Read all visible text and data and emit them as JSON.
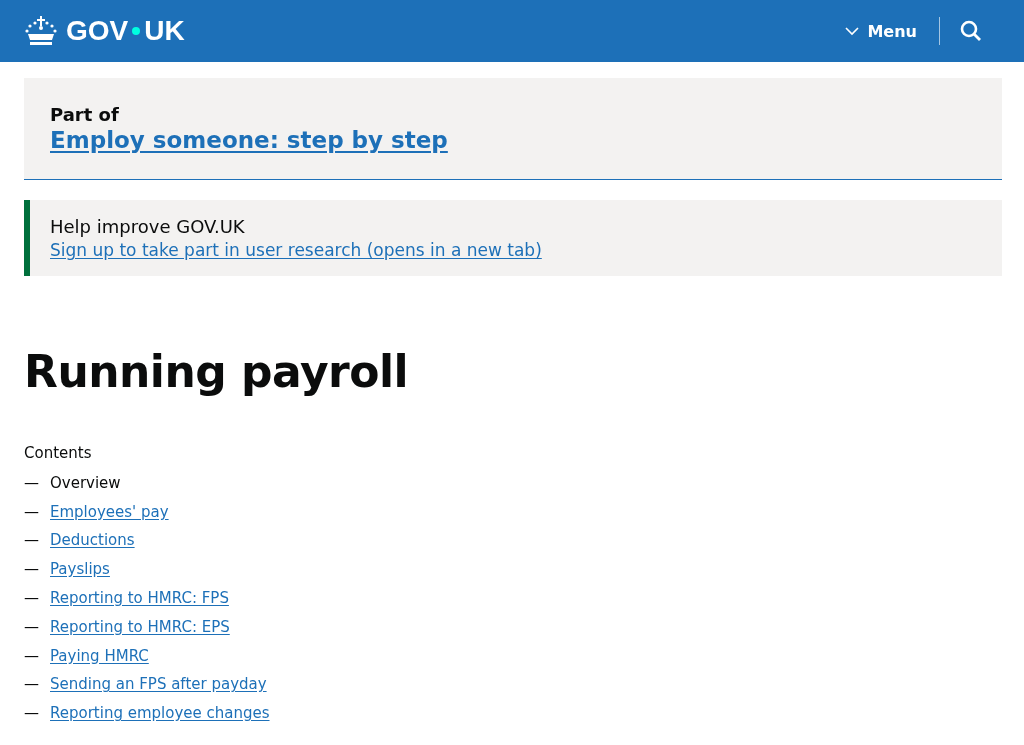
{
  "header": {
    "logo": {
      "left": "GOV",
      "right": "UK"
    },
    "menu": {
      "label": "Menu",
      "expanded": false
    }
  },
  "part_of": {
    "label": "Part of",
    "link": "Employ someone: step by step"
  },
  "banner": {
    "title": "Help improve GOV.UK",
    "link": "Sign up to take part in user research (opens in a new tab)"
  },
  "title": "Running payroll",
  "contents": {
    "heading": "Contents",
    "items": [
      {
        "marker": "—",
        "label": "Overview",
        "selected": true
      },
      {
        "marker": "—",
        "label": "Employees' pay",
        "selected": false
      },
      {
        "marker": "—",
        "label": "Deductions",
        "selected": false
      },
      {
        "marker": "—",
        "label": "Payslips",
        "selected": false
      },
      {
        "marker": "—",
        "label": "Reporting to HMRC: FPS",
        "selected": false
      },
      {
        "marker": "—",
        "label": "Reporting to HMRC: EPS",
        "selected": false
      },
      {
        "marker": "—",
        "label": "Paying HMRC",
        "selected": false
      },
      {
        "marker": "—",
        "label": "Sending an FPS after payday",
        "selected": false
      },
      {
        "marker": "—",
        "label": "Reporting employee changes",
        "selected": false
      }
    ]
  }
}
